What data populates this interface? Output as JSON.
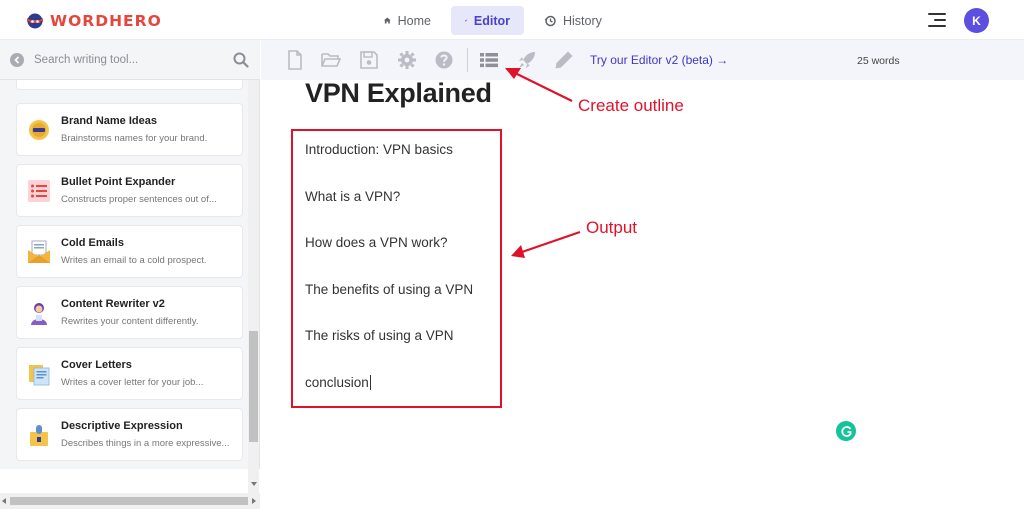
{
  "app": {
    "logo_word": "WORD",
    "logo_word2": "HERO"
  },
  "nav": {
    "items": [
      {
        "label": "Home",
        "icon": "home-icon"
      },
      {
        "label": "Editor",
        "icon": "pencil-icon",
        "active": true
      },
      {
        "label": "History",
        "icon": "history-icon"
      }
    ]
  },
  "user": {
    "avatar_letter": "K"
  },
  "sidebar": {
    "search_placeholder": "Search writing tool...",
    "tools": [
      {
        "title": "Brand Name Ideas",
        "desc": "Brainstorms names for your brand.",
        "icon": "badge-icon"
      },
      {
        "title": "Bullet Point Expander",
        "desc": "Constructs proper sentences out of...",
        "icon": "list-icon"
      },
      {
        "title": "Cold Emails",
        "desc": "Writes an email to a cold prospect.",
        "icon": "envelope-icon"
      },
      {
        "title": "Content Rewriter v2",
        "desc": "Rewrites your content differently.",
        "icon": "person-icon"
      },
      {
        "title": "Cover Letters",
        "desc": "Writes a cover letter for your job...",
        "icon": "documents-icon"
      },
      {
        "title": "Descriptive Expression",
        "desc": "Describes things in a more expressive...",
        "icon": "lightbulb-icon"
      }
    ]
  },
  "toolbar": {
    "link_label": "Try our Editor v2 (beta) →",
    "word_count": "25 words"
  },
  "document": {
    "title": "VPN Explained",
    "outline": [
      "Introduction: VPN basics",
      "What is a VPN?",
      "How does a VPN work?",
      "The benefits of using a VPN",
      "The risks of using a VPN",
      "conclusion"
    ]
  },
  "annotations": {
    "create_outline": "Create outline",
    "output": "Output",
    "color": "#e0122a"
  },
  "colors": {
    "brand": "#e5463e",
    "accent": "#4a3fcf",
    "annotation": "#e0122a"
  }
}
